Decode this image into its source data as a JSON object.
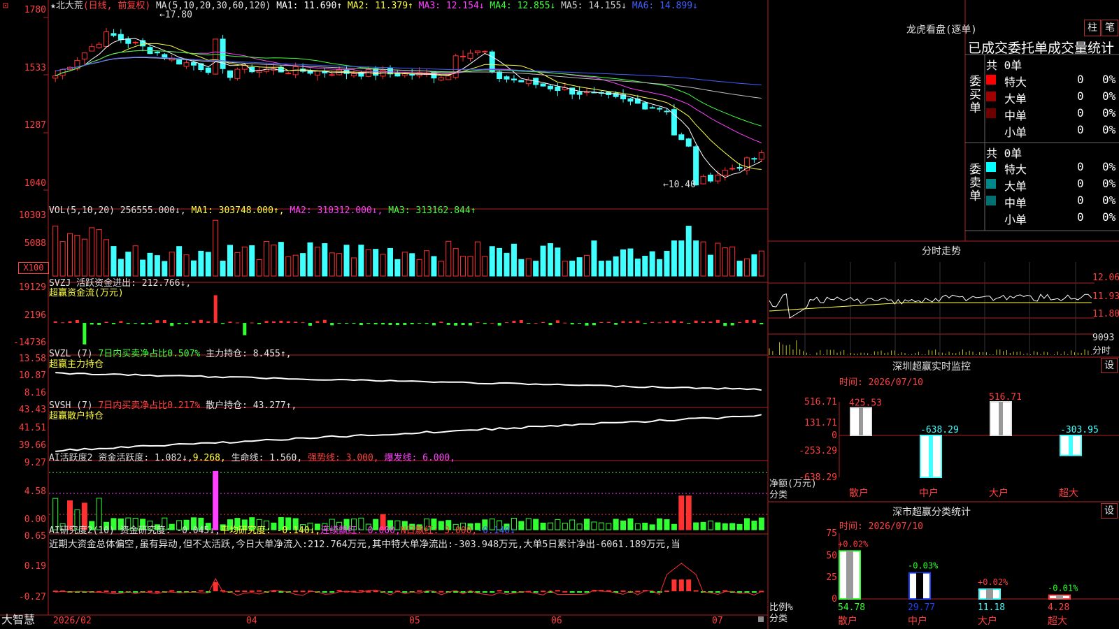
{
  "app": {
    "stock_name": "北大荒",
    "period": "(日线, 前复权)",
    "brand": "大智慧",
    "top_icon": "⊡"
  },
  "main": {
    "ma_header": {
      "params": "MA(5,10,20,30,60,120)",
      "items": [
        {
          "label": "MA1: 11.690↑",
          "color": "#ffffff"
        },
        {
          "label": "MA2: 11.379↑",
          "color": "#ffff40"
        },
        {
          "label": "MA3: 12.154↓",
          "color": "#ff40ff"
        },
        {
          "label": "MA4: 12.855↓",
          "color": "#40ff40"
        },
        {
          "label": "MA5: 14.155↓",
          "color": "#d0d0d0"
        },
        {
          "label": "MA6: 14.899↓",
          "color": "#4060ff"
        }
      ]
    },
    "y_labels": [
      "1780",
      "1533",
      "1287",
      "1040"
    ],
    "annotations": {
      "high": "17.80",
      "low": "10.40"
    }
  },
  "vol": {
    "header_name": "VOL(5,10,20)",
    "header_value": "256555.000↓,",
    "ma1": "MA1: 303748.000↑,",
    "ma2": "MA2: 310312.000↓,",
    "ma3": "MA3: 313162.844↑",
    "y_labels": [
      "10303",
      "5088"
    ],
    "unit": "X100"
  },
  "svzj": {
    "line1": "SVZJ  活跃资金进出: 212.766↓,",
    "line2": "超赢资金流(万元)",
    "y_labels": [
      "19129",
      "2196",
      "-14736"
    ]
  },
  "svzl": {
    "name": "SVZL (7)",
    "desc": "7日内买卖净占比0.507%",
    "value": "主力持仓: 8.455↑,",
    "sub": "超赢主力持仓",
    "y_labels": [
      "13.58",
      "10.87",
      "8.16"
    ]
  },
  "svsh": {
    "name": "SVSH (7)",
    "desc": "7日内买卖净占比0.217%",
    "value": "散户持仓: 43.277↑,",
    "sub": "超赢散户持仓",
    "y_labels": [
      "43.43",
      "41.51",
      "39.66"
    ]
  },
  "ai1": {
    "name": "AI活跃度2",
    "v1": "资金活跃度: 1.082↓,",
    "v2": "9.268,",
    "v3": "生命线: 1.560,",
    "v4": "强势线: 3.000,",
    "v5": "爆发线: 6.000,",
    "y_labels": [
      "9.27",
      "4.58",
      "0.00"
    ]
  },
  "ai2": {
    "name": "AI研究度2(10)",
    "v1": "资金研究度: -0.045↓,",
    "v2": "平均研究度: -0.140↓,",
    "v3": "连续飘红: 0.000,",
    "v4": "N日飘红: 3.000,",
    "v5": "-0.140↓",
    "note": "近期大资金总体偏空,虽有异动,但不太活跃,今日大单净流入:212.764万元,其中特大单净流出:-303.948万元,大单5日累计净出-6061.189万元,当",
    "y_labels": [
      "0.65",
      "0.19",
      "-0.27"
    ]
  },
  "x_axis": [
    "2026/02",
    "04",
    "05",
    "06",
    "07"
  ],
  "right": {
    "lhkp_title": "龙虎看盘(逐单)",
    "btn_zhu": "柱",
    "btn_bi": "笔",
    "stats_title": "已成交委托单成交量统计",
    "buy_label": "委买单",
    "sell_label": "委卖单",
    "buy_total": "共 0单",
    "sell_total": "共 0单",
    "buy_rows": [
      {
        "name": "特大",
        "count": "0",
        "pct": "0%",
        "color": "#ff0000"
      },
      {
        "name": "大单",
        "count": "0",
        "pct": "0%",
        "color": "#a00000"
      },
      {
        "name": "中单",
        "count": "0",
        "pct": "0%",
        "color": "#700000"
      },
      {
        "name": "小单",
        "count": "0",
        "pct": "0%",
        "color": ""
      }
    ],
    "sell_rows": [
      {
        "name": "特大",
        "count": "0",
        "pct": "0%",
        "color": "#00ffff"
      },
      {
        "name": "大单",
        "count": "0",
        "pct": "0%",
        "color": "#008888"
      },
      {
        "name": "中单",
        "count": "0",
        "pct": "0%",
        "color": "#007070"
      },
      {
        "name": "小单",
        "count": "0",
        "pct": "0%",
        "color": ""
      }
    ],
    "intraday_title": "分时走势",
    "intraday_prices": [
      "12.06",
      "11.93",
      "11.80"
    ],
    "intraday_vol": "9093",
    "intraday_unit": "分时",
    "sz_title": "深圳超赢实时监控",
    "set_label": "设",
    "sz_time": "时间: 2026/07/10",
    "sz_y_labels": [
      "516.71",
      "131.71",
      "0",
      "-253.29",
      "-638.29"
    ],
    "sz_side": [
      "净额(万元)",
      "分类"
    ],
    "sz_categories": [
      "散户",
      "中户",
      "大户",
      "超大"
    ],
    "sz_values": [
      "425.53",
      "-638.29",
      "516.71",
      "-303.95"
    ],
    "fl_title": "深市超赢分类统计",
    "fl_time": "时间: 2026/07/10",
    "fl_y_labels": [
      "75",
      "50",
      "25",
      "0"
    ],
    "fl_side": [
      "比例%",
      "分类"
    ],
    "fl_categories": [
      "散户",
      "中户",
      "大户",
      "超大"
    ],
    "fl_changes": [
      "+0.02%",
      "-0.03%",
      "+0.02%",
      "-0.01%"
    ],
    "fl_values": [
      "54.78",
      "29.77",
      "11.18",
      "4.28"
    ]
  },
  "chart_data": [
    {
      "type": "bar",
      "title": "深圳超赢实时监控",
      "ylabel": "净额(万元)",
      "categories": [
        "散户",
        "中户",
        "大户",
        "超大"
      ],
      "values": [
        425.53,
        -638.29,
        516.71,
        -303.95
      ],
      "ylim": [
        -638.29,
        516.71
      ]
    },
    {
      "type": "bar",
      "title": "深市超赢分类统计",
      "ylabel": "比例%",
      "categories": [
        "散户",
        "中户",
        "大户",
        "超大"
      ],
      "values": [
        54.78,
        29.77,
        11.18,
        4.28
      ],
      "ylim": [
        0,
        75
      ]
    },
    {
      "type": "line",
      "title": "北大荒 (日线, 前复权)",
      "y_ticks": [
        10.4,
        12.87,
        15.33,
        17.8
      ],
      "x_ticks": [
        "2026/02",
        "04",
        "05",
        "06",
        "07"
      ],
      "series": [
        {
          "name": "MA1",
          "last": 11.69
        },
        {
          "name": "MA2",
          "last": 11.379
        },
        {
          "name": "MA3",
          "last": 12.154
        },
        {
          "name": "MA4",
          "last": 12.855
        },
        {
          "name": "MA5",
          "last": 14.155
        },
        {
          "name": "MA6",
          "last": 14.899
        }
      ]
    }
  ]
}
